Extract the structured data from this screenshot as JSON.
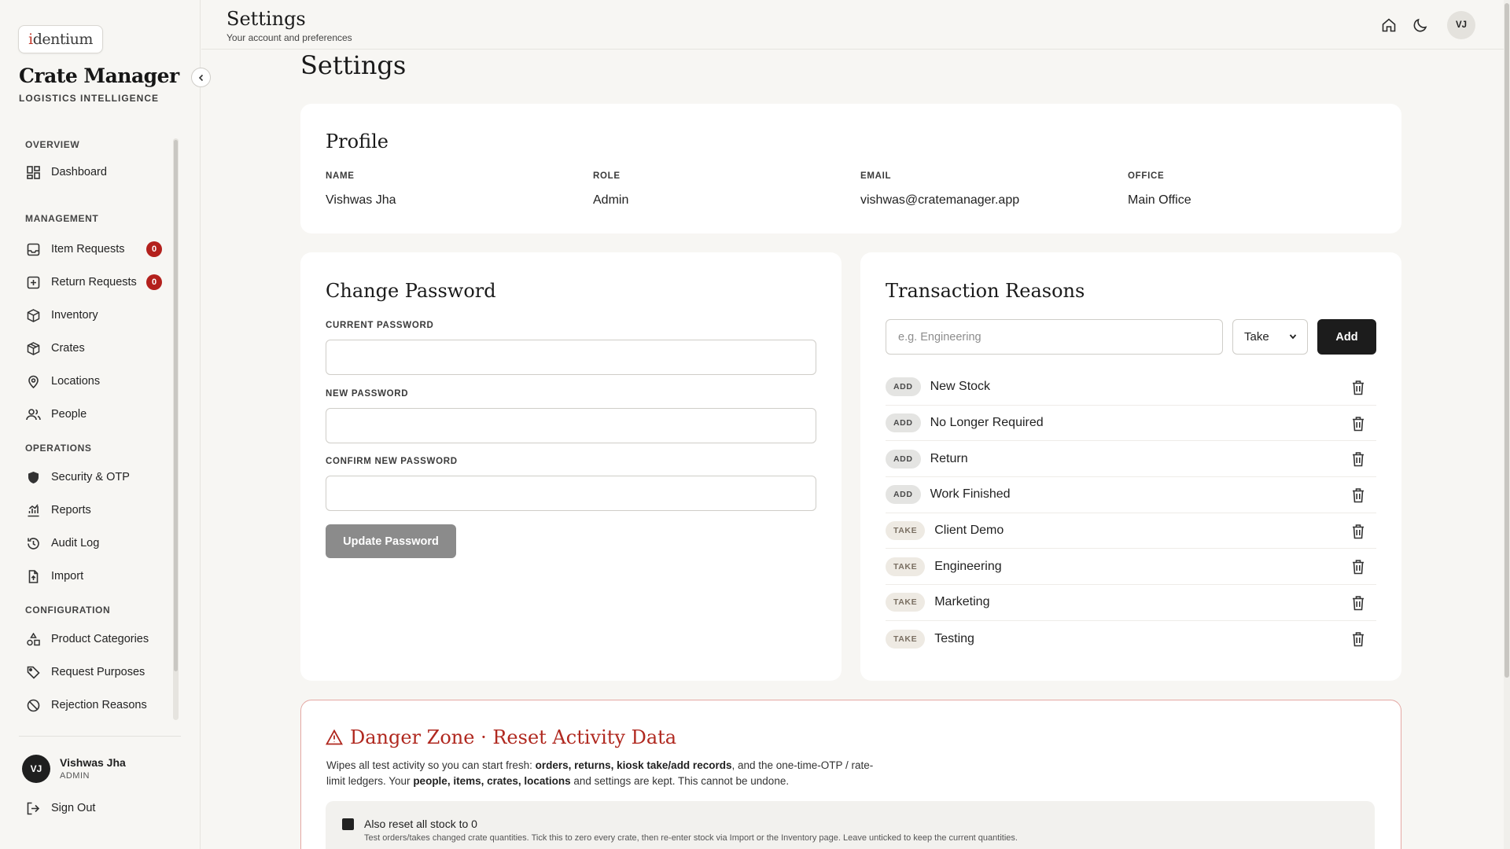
{
  "brand": {
    "logo_text": "identium",
    "app_title": "Crate Manager",
    "app_subtitle": "LOGISTICS INTELLIGENCE"
  },
  "sidebar": {
    "sections": [
      {
        "label": "OVERVIEW",
        "items": [
          {
            "label": "Dashboard",
            "icon": "dashboard-icon"
          }
        ]
      },
      {
        "label": "MANAGEMENT",
        "items": [
          {
            "label": "Item Requests",
            "icon": "inbox-icon",
            "badge": "0"
          },
          {
            "label": "Return Requests",
            "icon": "return-box-icon",
            "badge": "0"
          },
          {
            "label": "Inventory",
            "icon": "package-icon"
          },
          {
            "label": "Crates",
            "icon": "crate-icon"
          },
          {
            "label": "Locations",
            "icon": "map-pin-icon"
          },
          {
            "label": "People",
            "icon": "people-icon"
          }
        ]
      },
      {
        "label": "OPERATIONS",
        "items": [
          {
            "label": "Security & OTP",
            "icon": "shield-icon"
          },
          {
            "label": "Reports",
            "icon": "chart-icon"
          },
          {
            "label": "Audit Log",
            "icon": "history-icon"
          },
          {
            "label": "Import",
            "icon": "file-import-icon"
          }
        ]
      },
      {
        "label": "CONFIGURATION",
        "items": [
          {
            "label": "Product Categories",
            "icon": "shapes-icon"
          },
          {
            "label": "Request Purposes",
            "icon": "tag-icon"
          },
          {
            "label": "Rejection Reasons",
            "icon": "ban-icon"
          }
        ]
      }
    ],
    "user": {
      "initials": "VJ",
      "name": "Vishwas Jha",
      "role": "ADMIN"
    },
    "sign_out": "Sign Out"
  },
  "topbar": {
    "title": "Settings",
    "subtitle": "Your account and preferences",
    "avatar": "VJ"
  },
  "page": {
    "title": "Settings"
  },
  "profile": {
    "title": "Profile",
    "fields": [
      {
        "label": "NAME",
        "value": "Vishwas Jha"
      },
      {
        "label": "ROLE",
        "value": "Admin"
      },
      {
        "label": "EMAIL",
        "value": "vishwas@cratemanager.app"
      },
      {
        "label": "OFFICE",
        "value": "Main Office"
      }
    ]
  },
  "password": {
    "title": "Change Password",
    "current_label": "CURRENT PASSWORD",
    "new_label": "NEW PASSWORD",
    "confirm_label": "CONFIRM NEW PASSWORD",
    "button": "Update Password"
  },
  "reasons": {
    "title": "Transaction Reasons",
    "placeholder": "e.g. Engineering",
    "type_selected": "Take",
    "add_button": "Add",
    "items": [
      {
        "type": "ADD",
        "name": "New Stock"
      },
      {
        "type": "ADD",
        "name": "No Longer Required"
      },
      {
        "type": "ADD",
        "name": "Return"
      },
      {
        "type": "ADD",
        "name": "Work Finished"
      },
      {
        "type": "TAKE",
        "name": "Client Demo"
      },
      {
        "type": "TAKE",
        "name": "Engineering"
      },
      {
        "type": "TAKE",
        "name": "Marketing"
      },
      {
        "type": "TAKE",
        "name": "Testing"
      }
    ]
  },
  "danger": {
    "title": "Danger Zone · Reset Activity Data",
    "desc_parts": [
      "Wipes all test activity so you can start fresh: ",
      "orders, returns, kiosk take/add records",
      ", and the one-time-OTP / rate-limit ledgers. Your ",
      "people, items, crates, locations",
      " and settings are kept. This cannot be undone."
    ],
    "checkbox_label": "Also reset all stock to 0",
    "checkbox_help": "Test orders/takes changed crate quantities. Tick this to zero every crate, then re-enter stock via Import or the Inventory page. Leave unticked to keep the current quantities."
  },
  "colors": {
    "accent_dark": "#1c1c1c",
    "badge_red": "#b3201c",
    "danger_red": "#b0281f",
    "background": "#f7f6f3"
  }
}
